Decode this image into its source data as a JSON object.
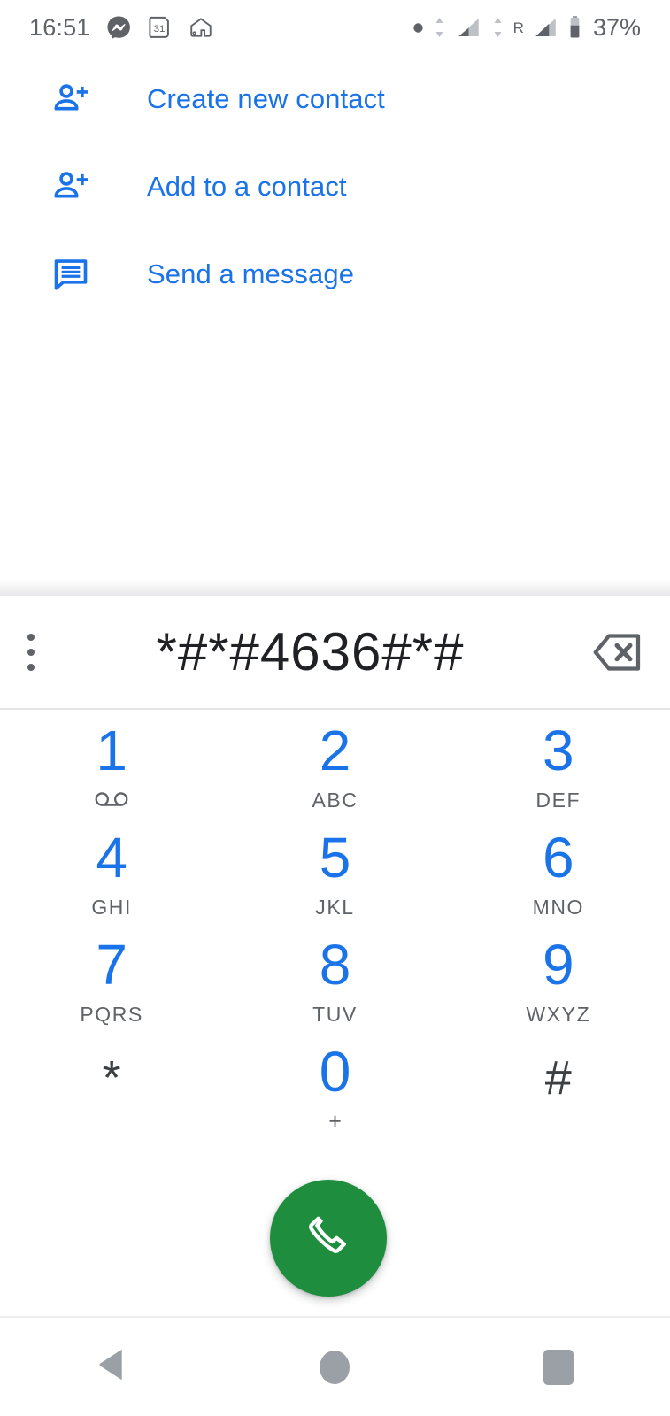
{
  "statusbar": {
    "time": "16:51",
    "battery_percent": "37%",
    "left_icons": [
      "messenger-icon",
      "calendar-icon",
      "home-icon"
    ],
    "calendar_day": "31",
    "roaming_label": "R",
    "right_icons": [
      "dot-icon",
      "data-transfer-icon",
      "signal-bars-icon",
      "data-transfer-icon-2",
      "roaming-signal-icon",
      "battery-icon"
    ],
    "colors": {
      "foreground": "#5f6368"
    }
  },
  "actions": {
    "items": [
      {
        "label": "Create new contact",
        "icon": "person-add-icon"
      },
      {
        "label": "Add to a contact",
        "icon": "person-add-icon"
      },
      {
        "label": "Send a message",
        "icon": "message-icon"
      }
    ]
  },
  "dialer": {
    "entered_number": "*#*#4636#*#",
    "overflow_icon": "more-vert-icon",
    "backspace_icon": "backspace-icon",
    "call_icon": "phone-icon",
    "keys": [
      {
        "digit": "1",
        "sub": "",
        "sub_icon": "voicemail-icon",
        "style": "blue"
      },
      {
        "digit": "2",
        "sub": "ABC",
        "sub_icon": "",
        "style": "blue"
      },
      {
        "digit": "3",
        "sub": "DEF",
        "sub_icon": "",
        "style": "blue"
      },
      {
        "digit": "4",
        "sub": "GHI",
        "sub_icon": "",
        "style": "blue"
      },
      {
        "digit": "5",
        "sub": "JKL",
        "sub_icon": "",
        "style": "blue"
      },
      {
        "digit": "6",
        "sub": "MNO",
        "sub_icon": "",
        "style": "blue"
      },
      {
        "digit": "7",
        "sub": "PQRS",
        "sub_icon": "",
        "style": "blue"
      },
      {
        "digit": "8",
        "sub": "TUV",
        "sub_icon": "",
        "style": "blue"
      },
      {
        "digit": "9",
        "sub": "WXYZ",
        "sub_icon": "",
        "style": "blue"
      },
      {
        "digit": "*",
        "sub": "",
        "sub_icon": "",
        "style": "gray"
      },
      {
        "digit": "0",
        "sub": "+",
        "sub_icon": "",
        "style": "blue"
      },
      {
        "digit": "#",
        "sub": "",
        "sub_icon": "",
        "style": "gray"
      }
    ]
  },
  "navbar": {
    "back_icon": "back-triangle-icon",
    "home_icon": "home-circle-icon",
    "recents_icon": "recents-square-icon"
  },
  "colors": {
    "accent_blue": "#1a73e8",
    "call_green": "#1e8e3e",
    "text_dark": "#202124",
    "text_gray": "#5f6368",
    "nav_gray": "#9aa0a6"
  }
}
